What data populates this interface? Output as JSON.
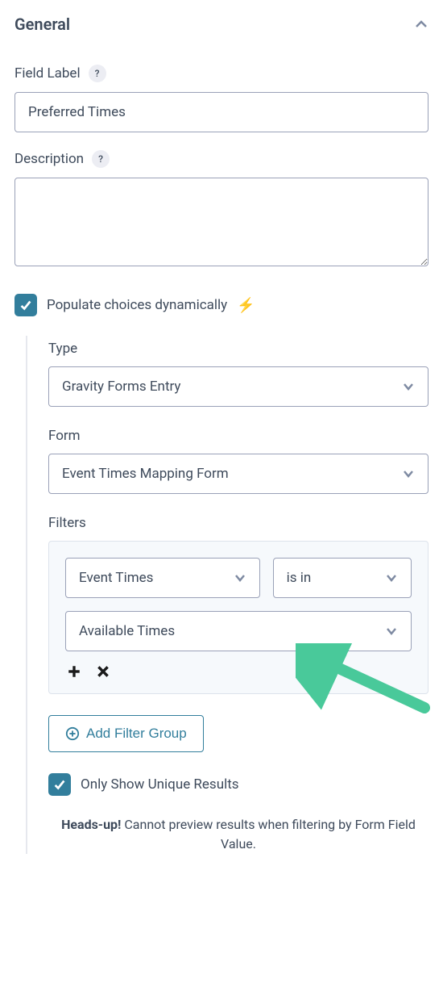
{
  "section": {
    "title": "General"
  },
  "fieldLabel": {
    "label": "Field Label",
    "value": "Preferred Times"
  },
  "description": {
    "label": "Description",
    "value": ""
  },
  "populate": {
    "label": "Populate choices dynamically"
  },
  "type": {
    "label": "Type",
    "value": "Gravity Forms Entry"
  },
  "form": {
    "label": "Form",
    "value": "Event Times Mapping Form"
  },
  "filters": {
    "label": "Filters",
    "field": "Event Times",
    "operator": "is in",
    "value": "Available Times"
  },
  "addFilterGroup": {
    "label": "Add Filter Group"
  },
  "uniqueResults": {
    "label": "Only Show Unique Results"
  },
  "headsup": {
    "prefix": "Heads-up!",
    "text": " Cannot preview results when filtering by Form Field Value."
  }
}
